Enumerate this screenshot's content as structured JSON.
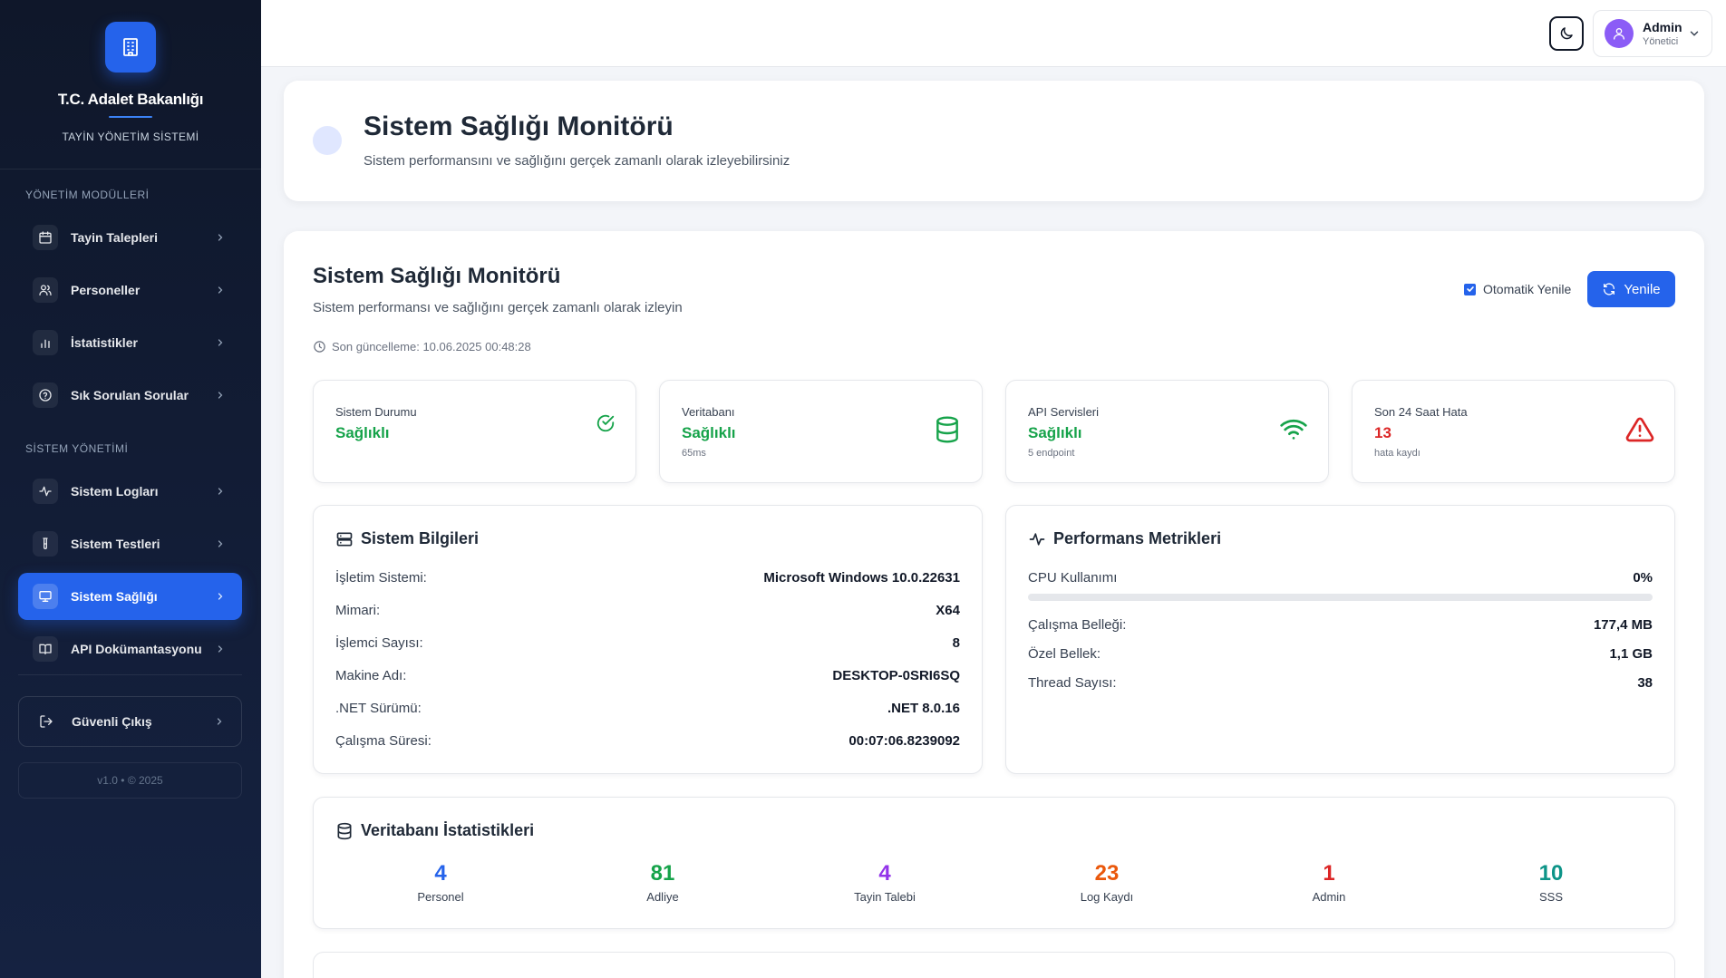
{
  "app": {
    "org_title": "T.C. Adalet Bakanlığı",
    "org_subtitle": "TAYİN YÖNETİM SİSTEMİ",
    "version": "v1.0 • © 2025"
  },
  "sidebar": {
    "section_management": "YÖNETİM MODÜLLERİ",
    "section_system": "SİSTEM YÖNETİMİ",
    "management_items": [
      {
        "label": "Tayin Talepleri",
        "icon": "calendar-icon"
      },
      {
        "label": "Personeller",
        "icon": "users-icon"
      },
      {
        "label": "İstatistikler",
        "icon": "bar-chart-icon"
      },
      {
        "label": "Sık Sorulan Sorular",
        "icon": "help-circle-icon"
      }
    ],
    "system_items": [
      {
        "label": "Sistem Logları",
        "icon": "activity-icon"
      },
      {
        "label": "Sistem Testleri",
        "icon": "test-tube-icon"
      },
      {
        "label": "Sistem Sağlığı",
        "icon": "monitor-icon",
        "active": true
      },
      {
        "label": "API Dokümantasyonu",
        "icon": "book-icon"
      }
    ],
    "logout_label": "Güvenli Çıkış"
  },
  "topbar": {
    "user_name": "Admin",
    "user_role": "Yönetici"
  },
  "header": {
    "title": "Sistem Sağlığı Monitörü",
    "subtitle": "Sistem performansını ve sağlığını gerçek zamanlı olarak izleyebilirsiniz"
  },
  "monitor": {
    "title": "Sistem Sağlığı Monitörü",
    "subtitle": "Sistem performansı ve sağlığını gerçek zamanlı olarak izleyin",
    "last_update": "Son güncelleme: 10.06.2025 00:48:28",
    "auto_refresh_label": "Otomatik Yenile",
    "auto_refresh_checked": true,
    "refresh_label": "Yenile"
  },
  "status_cards": [
    {
      "label": "Sistem Durumu",
      "value": "Sağlıklı",
      "note": "",
      "color": "#16a34a",
      "icon": "check-circle-icon"
    },
    {
      "label": "Veritabanı",
      "value": "Sağlıklı",
      "note": "65ms",
      "color": "#16a34a",
      "icon": "database-icon"
    },
    {
      "label": "API Servisleri",
      "value": "Sağlıklı",
      "note": "5 endpoint",
      "color": "#16a34a",
      "icon": "wifi-icon"
    },
    {
      "label": "Son 24 Saat Hata",
      "value": "13",
      "note": "hata kaydı",
      "color": "#dc2626",
      "icon": "alert-triangle-icon"
    }
  ],
  "system_info": {
    "title": "Sistem Bilgileri",
    "rows": [
      {
        "key": "İşletim Sistemi:",
        "value": "Microsoft Windows 10.0.22631"
      },
      {
        "key": "Mimari:",
        "value": "X64"
      },
      {
        "key": "İşlemci Sayısı:",
        "value": "8"
      },
      {
        "key": "Makine Adı:",
        "value": "DESKTOP-0SRI6SQ"
      },
      {
        "key": ".NET Sürümü:",
        "value": ".NET 8.0.16"
      },
      {
        "key": "Çalışma Süresi:",
        "value": "00:07:06.8239092"
      }
    ]
  },
  "performance": {
    "title": "Performans Metrikleri",
    "cpu_label": "CPU Kullanımı",
    "cpu_value": "0%",
    "cpu_fraction": 0,
    "rows": [
      {
        "key": "Çalışma Belleği:",
        "value": "177,4 MB"
      },
      {
        "key": "Özel Bellek:",
        "value": "1,1 GB"
      },
      {
        "key": "Thread Sayısı:",
        "value": "38"
      }
    ]
  },
  "db_stats": {
    "title": "Veritabanı İstatistikleri",
    "items": [
      {
        "value": "4",
        "label": "Personel",
        "color": "#2563eb"
      },
      {
        "value": "81",
        "label": "Adliye",
        "color": "#16a34a"
      },
      {
        "value": "4",
        "label": "Tayin Talebi",
        "color": "#9333ea"
      },
      {
        "value": "23",
        "label": "Log Kaydı",
        "color": "#ea580c"
      },
      {
        "value": "1",
        "label": "Admin",
        "color": "#dc2626"
      },
      {
        "value": "10",
        "label": "SSS",
        "color": "#0d9488"
      }
    ]
  }
}
